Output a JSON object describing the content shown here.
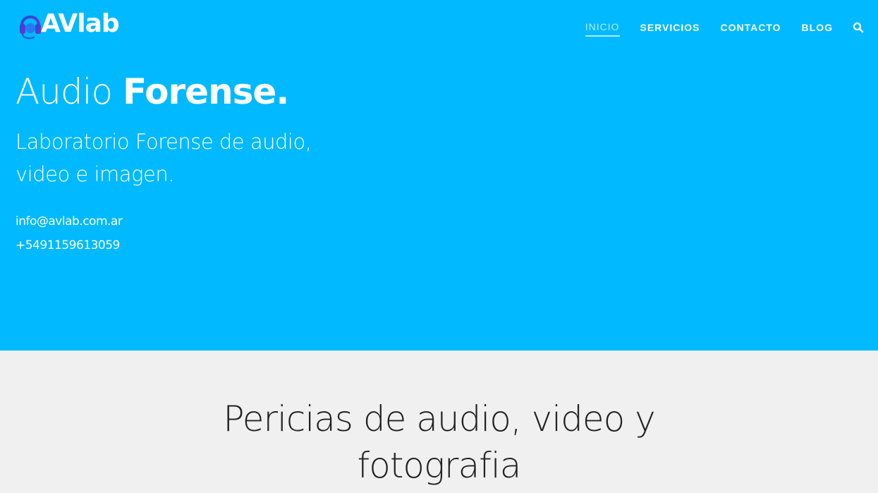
{
  "brand": {
    "logo_text": "AVlab",
    "logo_icon": "headphones-icon"
  },
  "nav": {
    "items": [
      {
        "label": "INICIO",
        "active": true
      },
      {
        "label": "SERVICIOS",
        "active": false
      },
      {
        "label": "CONTACTO",
        "active": false
      },
      {
        "label": "BLOG",
        "active": false
      }
    ],
    "search_icon": "search-icon"
  },
  "hero": {
    "title_light": "Audio ",
    "title_bold": "Forense.",
    "subtitle_line1": "Laboratorio Forense de audio,",
    "subtitle_line2": "video e imagen.",
    "email": "info@avlab.com.ar",
    "phone": "+5491159613059"
  },
  "section": {
    "title_line1": "Pericias de audio, video y",
    "title_line2": "fotografia"
  },
  "colors": {
    "hero_bg": "#00b9ff",
    "section_bg": "#f0f0f0",
    "text_dark": "#222222",
    "text_light": "#ffffff"
  }
}
